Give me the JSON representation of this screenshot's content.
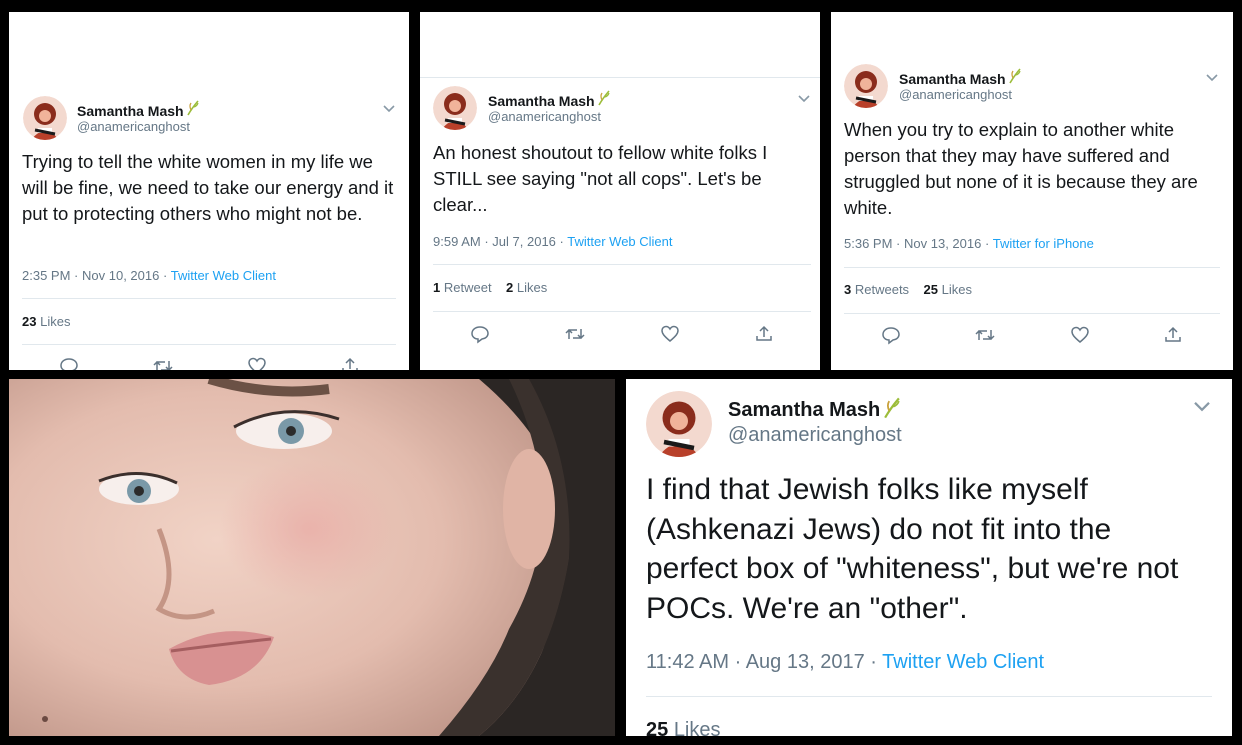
{
  "tweets": [
    {
      "name": "Samantha Mash",
      "handle": "@anamericanghost",
      "text": "Trying to tell the white women in my life we will be fine, we need to take our energy and it put to protecting others who might not be.",
      "time": "2:35 PM",
      "date": "Nov 10, 2016",
      "client": "Twitter Web Client",
      "likes_count": "23",
      "likes_label": "Likes"
    },
    {
      "name": "Samantha Mash",
      "handle": "@anamericanghost",
      "text": "An honest shoutout to fellow white folks I STILL see saying \"not all cops\". Let's be clear...",
      "time": "9:59 AM",
      "date": "Jul 7, 2016",
      "client": "Twitter Web Client",
      "retweets_count": "1",
      "retweets_label": "Retweet",
      "likes_count": "2",
      "likes_label": "Likes"
    },
    {
      "name": "Samantha Mash",
      "handle": "@anamericanghost",
      "text": "When you try to explain to another white person that they may have suffered and struggled but none of it is because they are white.",
      "time": "5:36 PM",
      "date": "Nov 13, 2016",
      "client": "Twitter for iPhone",
      "retweets_count": "3",
      "retweets_label": "Retweets",
      "likes_count": "25",
      "likes_label": "Likes"
    },
    {
      "name": "Samantha Mash",
      "handle": "@anamericanghost",
      "text": "I find that Jewish folks like myself (Ashkenazi Jews) do not fit into the perfect box of \"whiteness\", but we're not POCs. We're an \"other\".",
      "time": "11:42 AM",
      "date": "Aug 13, 2017",
      "client": "Twitter Web Client",
      "likes_count": "25",
      "likes_label": "Likes"
    }
  ],
  "separator": "·",
  "icons": {
    "verified_style": "leaf-icon",
    "actions": [
      "reply-icon",
      "retweet-icon",
      "like-icon",
      "share-icon"
    ]
  },
  "colors": {
    "link": "#1da1f2",
    "muted": "#657786",
    "text": "#14171a",
    "divider": "#e1e8ed"
  }
}
